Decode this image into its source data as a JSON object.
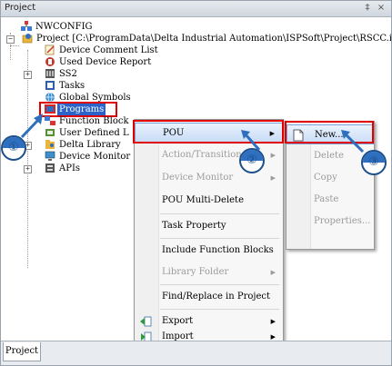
{
  "window": {
    "title": "Project",
    "pin_glyph": "‡",
    "close_glyph": "×"
  },
  "tree": {
    "nwconfig": "NWCONFIG",
    "project": "Project [C:\\ProgramData\\Delta Industrial Automation\\ISPSoft\\Project\\RSCC.isp]",
    "device_comment_list": "Device Comment List",
    "used_device_report": "Used Device Report",
    "ss2": "SS2",
    "tasks": "Tasks",
    "global_symbols": "Global Symbols",
    "programs": "Programs",
    "function_blocks": "Function Block",
    "user_defined": "User Defined L",
    "delta_library": "Delta Library",
    "device_monitor": "Device Monitor",
    "apis": "APIs"
  },
  "context_menu": {
    "pou": "POU",
    "action_transition": "Action/Transition",
    "device_monitor": "Device Monitor",
    "pou_multi_delete": "POU Multi-Delete",
    "task_property": "Task Property",
    "include_function_blocks": "Include Function Blocks",
    "library_folder": "Library Folder",
    "find_replace": "Find/Replace in Project",
    "export": "Export",
    "import": "Import"
  },
  "submenu": {
    "new": "New...",
    "delete": "Delete",
    "copy": "Copy",
    "paste": "Paste",
    "properties": "Properties..."
  },
  "markers": [
    "①",
    "②",
    "③"
  ],
  "bottom_tab": "Project",
  "colors": {
    "highlight_red": "#e00000",
    "selection_blue": "#2b63c9",
    "marker_blue": "#2e6fbf"
  }
}
